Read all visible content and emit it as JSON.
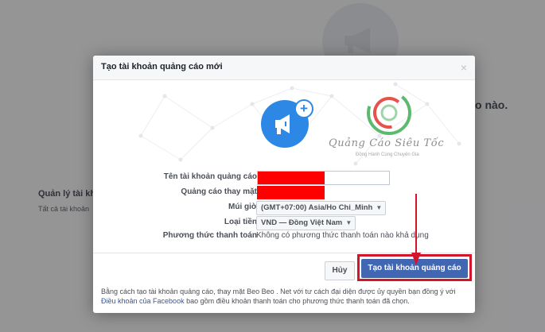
{
  "background": {
    "right_text": "o nào.",
    "left_title": "Quản lý tài kh",
    "left_sub": "Tất cả tài khoản"
  },
  "modal": {
    "title": "Tạo tài khoản quảng cáo mới",
    "close_label": "×",
    "brand_name": "Quảng Cáo Siêu Tốc",
    "brand_slogan": "Đồng Hành Cùng Chuyên Gia",
    "plus_label": "+",
    "form": {
      "account_name_label": "Tên tài khoản quảng cáo",
      "account_name_value": "",
      "on_behalf_label": "Quảng cáo thay mặt",
      "on_behalf_value": "",
      "timezone_label": "Múi giờ",
      "timezone_value": "(GMT+07:00) Asia/Ho Chi_Minh",
      "currency_label": "Loại tiền",
      "currency_value": "VND — Đồng Việt Nam",
      "payment_label": "Phương thức thanh toán",
      "payment_value": "Không có phương thức thanh toán nào khả dụng"
    },
    "buttons": {
      "cancel": "Hủy",
      "create": "Tạo tài khoản quảng cáo"
    },
    "footer": {
      "text_1": "Bằng cách tạo tài khoản quảng cáo, thay mặt Beo Beo . Net với tư cách đại diện được ủy quyền bạn đồng ý với ",
      "link": "Điều khoản của Facebook",
      "text_2": " bao gồm điều khoản thanh toán cho phương thức thanh toán đã chọn."
    }
  },
  "icons": {
    "ad_icon": "megaphone-icon",
    "plus_icon": "plus-icon",
    "close_icon": "close-icon",
    "caret": "chevron-down-icon"
  },
  "colors": {
    "primary_button": "#4267b2",
    "highlight_frame": "#d3152b",
    "redaction": "#fe0000",
    "ad_icon_blue": "#2d88e5"
  }
}
